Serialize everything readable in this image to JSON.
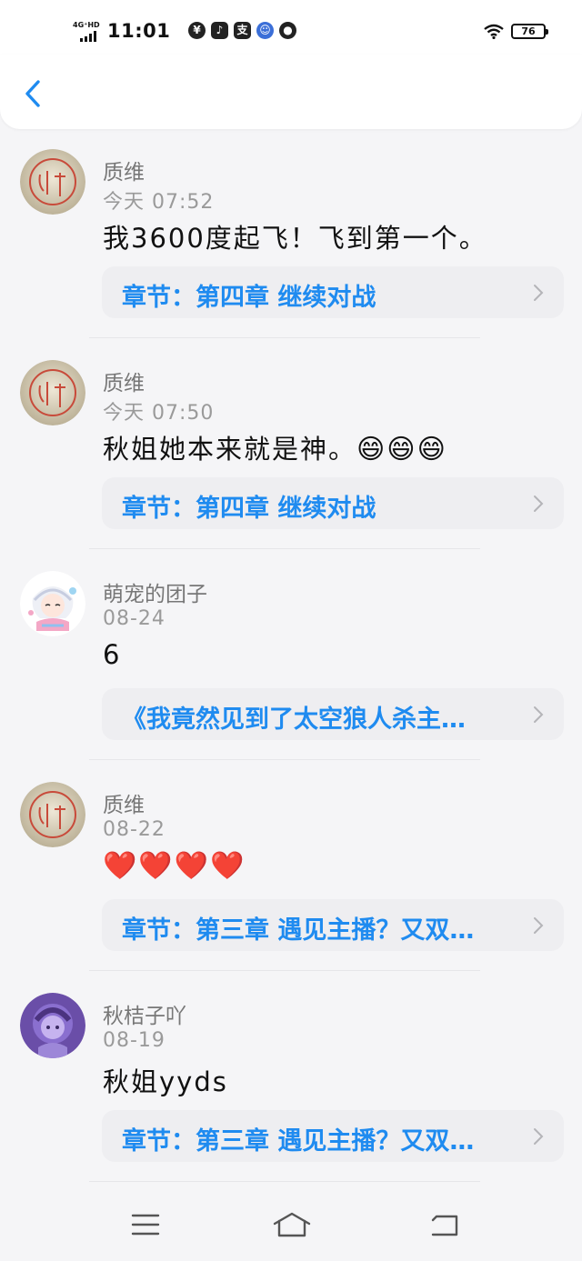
{
  "status": {
    "network": "4G⁺HD",
    "time": "11:01",
    "app_icons": [
      "¥",
      "♪",
      "支",
      "☺",
      "●"
    ],
    "battery": "76"
  },
  "nav": {
    "back_icon": "chevron-left-icon",
    "accent": "#1f8bf0"
  },
  "comments": [
    {
      "name": "质维",
      "time": "今天 07:52",
      "text": "我3600度起飞！飞到第一个。",
      "emoji": "",
      "chapter": "章节：第四章 继续对战"
    },
    {
      "name": "质维",
      "time": "今天 07:50",
      "text": "秋姐她本来就是神。",
      "emoji": "😄😄😄",
      "chapter": "章节：第四章 继续对战"
    },
    {
      "name": "萌宠的团子",
      "time": "08-24",
      "text": "6",
      "emoji": "",
      "chapter": "《我竟然见到了太空狼人杀主…"
    },
    {
      "name": "质维",
      "time": "08-22",
      "text": "",
      "emoji": "❤️❤️❤️❤️",
      "chapter": "章节：第三章 遇见主播？又双…"
    },
    {
      "name": "秋桔子吖",
      "time": "08-19",
      "text": "秋姐yyds",
      "emoji": "",
      "chapter": "章节：第三章 遇见主播？又双…"
    }
  ],
  "system_nav": [
    "menu-icon",
    "home-icon",
    "back-icon"
  ]
}
